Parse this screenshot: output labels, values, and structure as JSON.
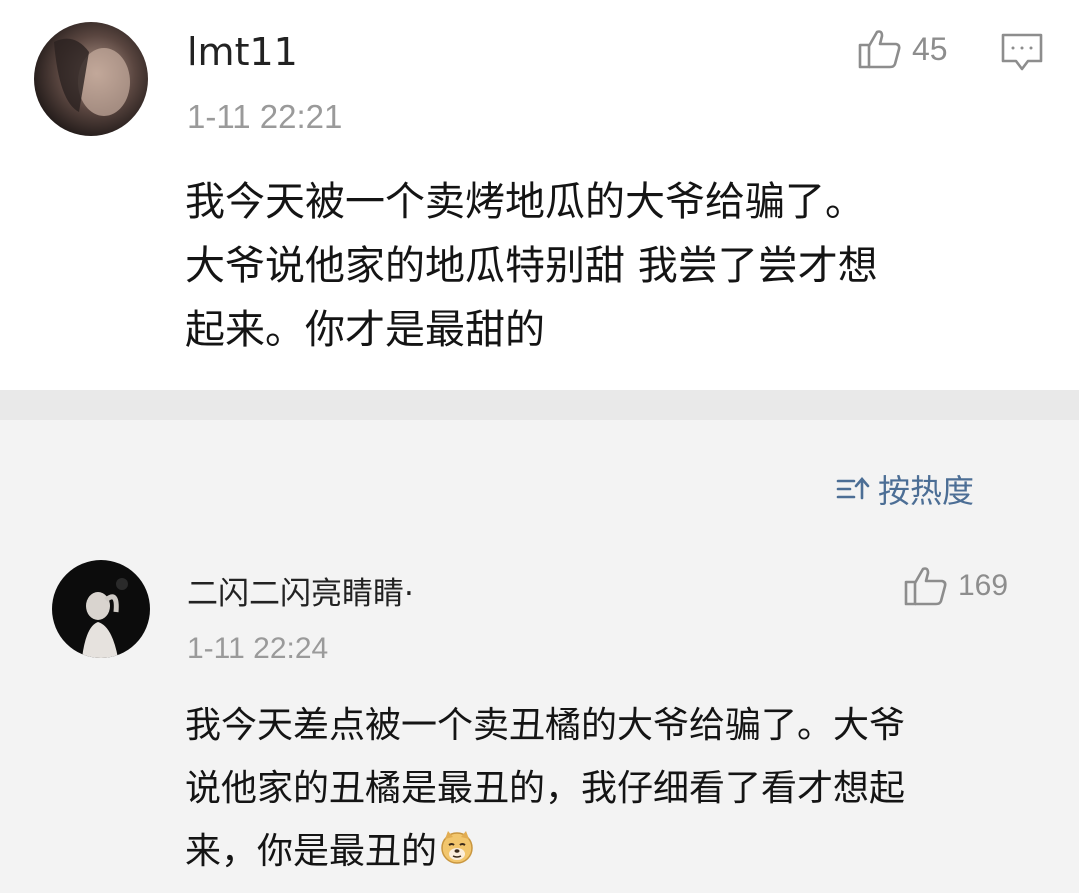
{
  "comments": [
    {
      "username": "lmt11",
      "time": "1-11 22:21",
      "likes": "45",
      "lines": [
        "我今天被一个卖烤地瓜的大爷给骗了。",
        "大爷说他家的地瓜特别甜 我尝了尝才想",
        "起来。你才是最甜的"
      ]
    },
    {
      "username": "二闪二闪亮睛睛·",
      "time": "1-11 22:24",
      "likes": "169",
      "lines": [
        "我今天差点被一个卖丑橘的大爷给骗了。大爷",
        "说他家的丑橘是最丑的，我仔细看了看才想起",
        "来，你是最丑的"
      ],
      "emoji": "doge-emoji"
    }
  ],
  "sort": {
    "label": "按热度",
    "icon": "sort-icon"
  },
  "icons": [
    "thumbs-up-icon",
    "reply-comment-icon",
    "avatar"
  ],
  "colors": {
    "link": "#4c6e95",
    "muted": "#9a9a9a",
    "text": "#141414"
  }
}
